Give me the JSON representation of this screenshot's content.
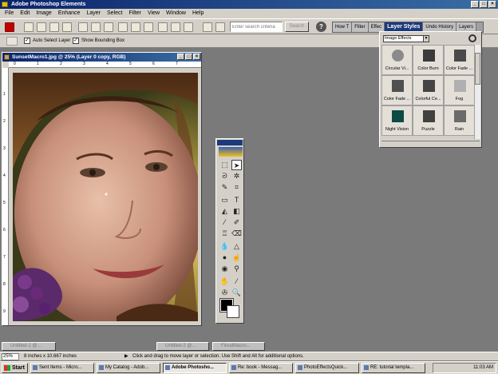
{
  "app": {
    "title": "Adobe Photoshop Elements"
  },
  "menu": [
    "File",
    "Edit",
    "Image",
    "Enhance",
    "Layer",
    "Select",
    "Filter",
    "View",
    "Window",
    "Help"
  ],
  "toolbar": {
    "search_placeholder": "Enter search criteria",
    "search_button": "Search",
    "help_label": "?"
  },
  "palette_well": {
    "tabs": [
      "How T",
      "Filter",
      "Effec",
      "Layer Styles",
      "Undo History",
      "Layers"
    ]
  },
  "options_bar": {
    "auto_select_label": "Auto Select Layer",
    "bounding_box_label": "Show Bounding Box",
    "check_mark": "✓"
  },
  "document": {
    "title": "SunsetMacro1.jpg @ 25% (Layer 0 copy, RGB)",
    "ruler_h": [
      "0",
      "1",
      "2",
      "3",
      "4",
      "5",
      "6",
      "7"
    ],
    "ruler_v": [
      "1",
      "2",
      "3",
      "4",
      "5",
      "6",
      "7",
      "8",
      "9"
    ]
  },
  "layer_styles": {
    "dropdown_value": "Image Effects",
    "items": [
      {
        "label": "Circular Vi...",
        "color": "#8a8a8a"
      },
      {
        "label": "Color Burn",
        "color": "#3a3a3a"
      },
      {
        "label": "Color Fade ...",
        "color": "#4a4a4a"
      },
      {
        "label": "Color Fade ...",
        "color": "#505050"
      },
      {
        "label": "Colorful Ce...",
        "color": "#444444"
      },
      {
        "label": "Fog",
        "color": "#b0b0b0"
      },
      {
        "label": "Night Vision",
        "color": "#0e4a44"
      },
      {
        "label": "Puzzle",
        "color": "#404040"
      },
      {
        "label": "Rain",
        "color": "#6a6a6a"
      }
    ]
  },
  "minimized_docs": [
    "Untitled-1 @...",
    "Untitled-2 @...",
    "FloralMacro..."
  ],
  "status": {
    "zoom": "25%",
    "doc_size": "8 inches x 10.667 inches",
    "hint": "Click and drag to move layer or selection. Use Shift and Alt for additional options."
  },
  "taskbar": {
    "start_label": "Start",
    "items": [
      "Sent Items - Micro...",
      "My Catalog - Adob...",
      "Adobe Photosho...",
      "Re: book - Messag...",
      "PhotoEffectsQuick...",
      "RE: tutorial templa..."
    ],
    "active_index": 2,
    "clock": "11:03 AM"
  }
}
